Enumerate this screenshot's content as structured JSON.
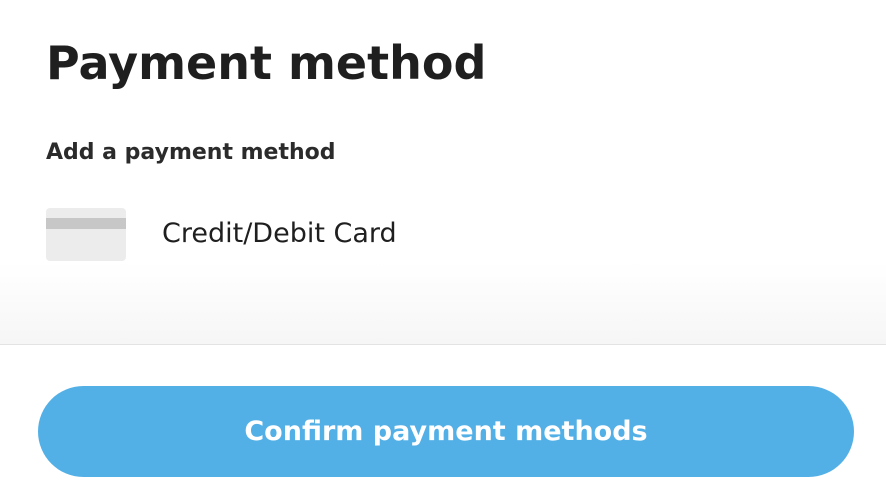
{
  "header": {
    "title": "Payment method"
  },
  "section": {
    "label": "Add a payment method"
  },
  "methods": [
    {
      "label": "Credit/Debit Card",
      "icon": "credit-card-icon"
    }
  ],
  "footer": {
    "confirm_label": "Confirm payment methods"
  },
  "colors": {
    "accent": "#53b0e6",
    "card_icon": "#ececec",
    "card_stripe": "#c7c7c7"
  }
}
